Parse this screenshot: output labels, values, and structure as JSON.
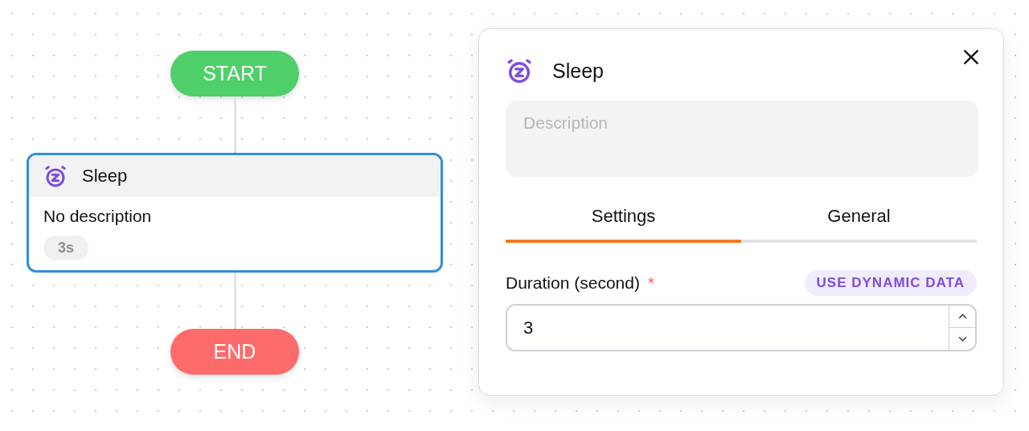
{
  "canvas": {
    "nodes": [
      {
        "kind": "start",
        "label": "START"
      },
      {
        "kind": "action",
        "title": "Sleep",
        "description": "No description",
        "badge": "3s",
        "selected": true
      },
      {
        "kind": "end",
        "label": "END"
      }
    ]
  },
  "panel": {
    "title": "Sleep",
    "description": {
      "placeholder": "Description"
    },
    "tabs": [
      {
        "label": "Settings",
        "selected": true
      },
      {
        "label": "General",
        "selected": false
      }
    ],
    "field": {
      "label": "Duration (second)",
      "required_mark": "*",
      "dynamic_button": "USE DYNAMIC DATA",
      "value": "3"
    }
  }
}
